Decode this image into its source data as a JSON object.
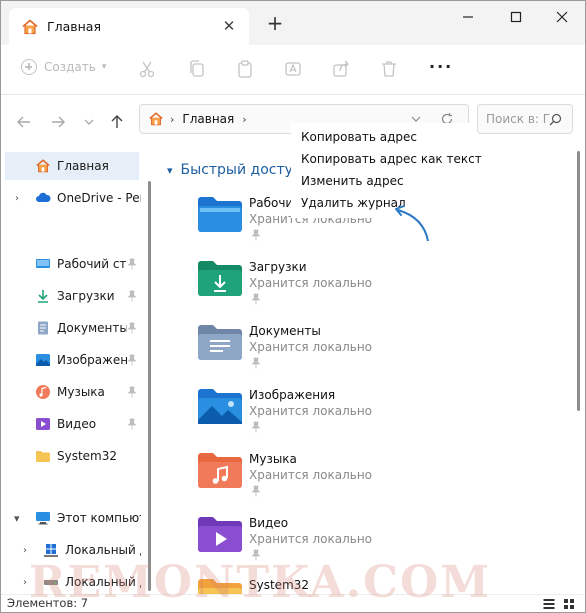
{
  "window": {
    "tab_title": "Главная",
    "close_tab_glyph": "✕",
    "new_tab_glyph": "+"
  },
  "toolbar": {
    "create_label": "Создать",
    "create_caret": "▾",
    "more_glyph": "···"
  },
  "address_bar": {
    "separator": "›",
    "path": "Главная",
    "separator_trailing": "›"
  },
  "search": {
    "placeholder": "Поиск в: Г"
  },
  "sidebar": {
    "items": [
      {
        "label": "Главная",
        "icon": "home-icon",
        "pinned": false
      },
      {
        "label": "OneDrive - Personal",
        "icon": "cloud-icon",
        "pinned": false
      },
      {
        "label": "Рабочий стол",
        "icon": "desktop-icon",
        "pinned": true
      },
      {
        "label": "Загрузки",
        "icon": "download-icon",
        "pinned": true
      },
      {
        "label": "Документы",
        "icon": "documents-icon",
        "pinned": true
      },
      {
        "label": "Изображения",
        "icon": "pictures-icon",
        "pinned": true
      },
      {
        "label": "Музыка",
        "icon": "music-icon",
        "pinned": true
      },
      {
        "label": "Видео",
        "icon": "video-icon",
        "pinned": true
      },
      {
        "label": "System32",
        "icon": "folder-icon",
        "pinned": false
      },
      {
        "label": "Этот компьютер",
        "icon": "computer-icon",
        "pinned": false
      },
      {
        "label": "Локальный диск (C:)",
        "icon": "drive-icon",
        "pinned": false
      },
      {
        "label": "Локальный диск (D:)",
        "icon": "drive-icon",
        "pinned": false
      }
    ]
  },
  "content": {
    "section_title": "Быстрый доступ",
    "folders": [
      {
        "name": "Рабочий стол",
        "subtitle": "Хранится локально",
        "icon": "desktop-folder-icon"
      },
      {
        "name": "Загрузки",
        "subtitle": "Хранится локально",
        "icon": "downloads-folder-icon"
      },
      {
        "name": "Документы",
        "subtitle": "Хранится локально",
        "icon": "documents-folder-icon"
      },
      {
        "name": "Изображения",
        "subtitle": "Хранится локально",
        "icon": "pictures-folder-icon"
      },
      {
        "name": "Музыка",
        "subtitle": "Хранится локально",
        "icon": "music-folder-icon"
      },
      {
        "name": "Видео",
        "subtitle": "Хранится локально",
        "icon": "video-folder-icon"
      },
      {
        "name": "System32",
        "subtitle": "",
        "icon": "folder-icon"
      }
    ]
  },
  "context_menu": {
    "items": [
      "Копировать адрес",
      "Копировать адрес как текст",
      "Изменить адрес",
      "Удалить журнал"
    ]
  },
  "status": {
    "items_text": "Элементов: 7"
  },
  "watermark": "REMONTKA.COM",
  "colors": {
    "accent": "#1f5fa0",
    "arrow": "#2a78c5",
    "folder_blue": "#2a8fe0",
    "folder_green": "#1fa37a",
    "folder_orange": "#f2a23a",
    "folder_purple": "#8a4fd1"
  }
}
